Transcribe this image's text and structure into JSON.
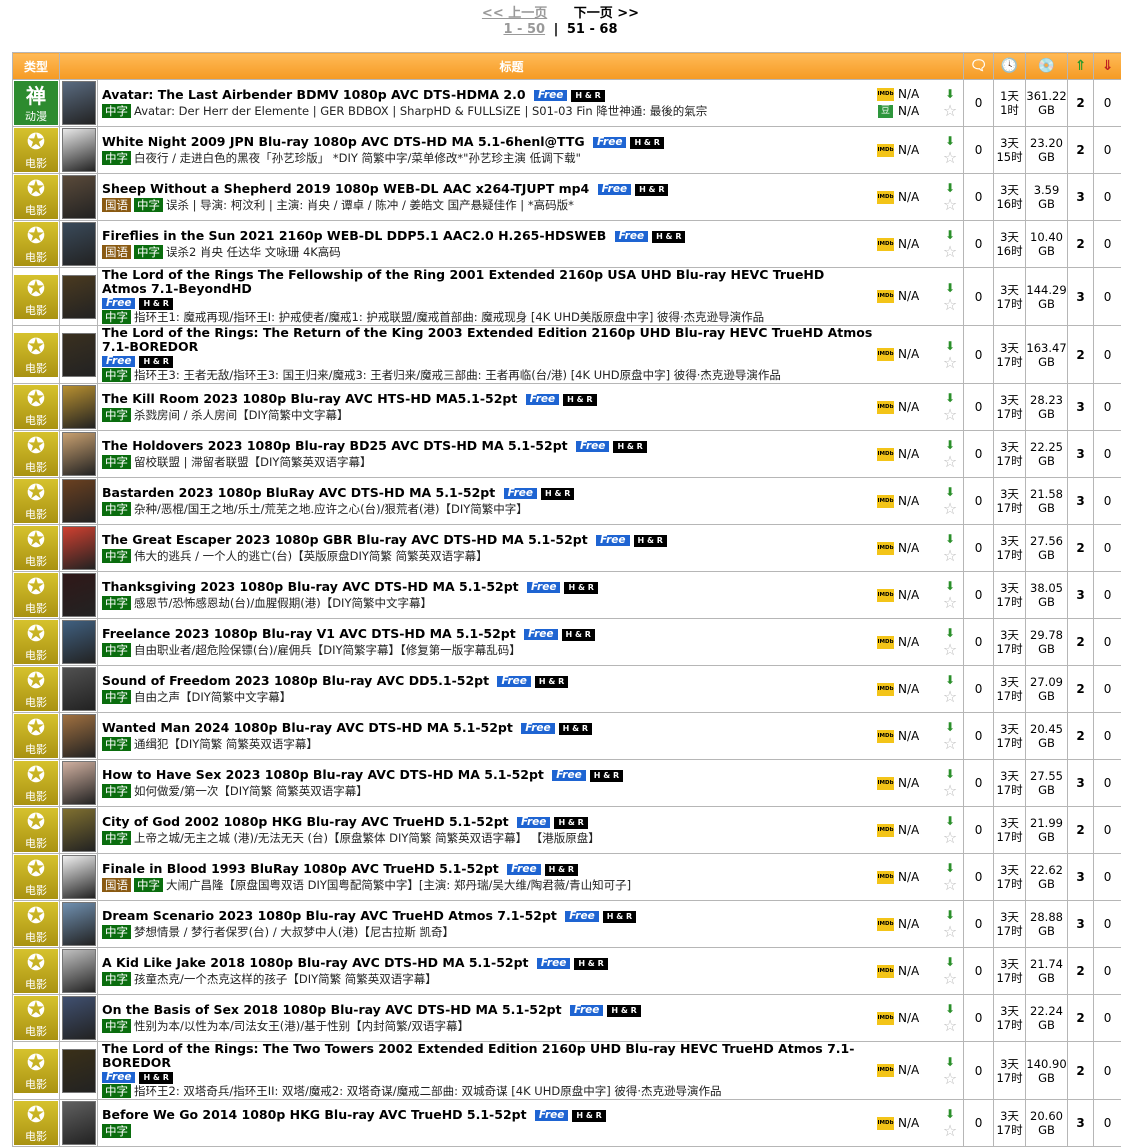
{
  "pager": {
    "prev": "<< 上一页",
    "next": "下一页 >>",
    "range1": "1 - 50",
    "sep": "|",
    "range2": "51 - 68"
  },
  "header": {
    "type": "类型",
    "title": "标题"
  },
  "rows": [
    {
      "cat": "anime",
      "cat_icon": "禅",
      "cat_label": "动漫",
      "color": "#5a6b80",
      "title": "Avatar: The Last Airbender BDMV 1080p AVC DTS-HDMA 2.0",
      "free": "Free",
      "hr": "H & R",
      "wrap": false,
      "tags": [
        "中字"
      ],
      "sub": "Avatar: Der Herr der Elemente | GER BDBOX | SharpHD & FULLSiZE | S01-03 Fin 降世神通: 最後的氣宗",
      "imdb": "N/A",
      "douban": "N/A",
      "comments": "0",
      "t1": "1天",
      "t2": "1时",
      "s1": "361.22",
      "s2": "GB",
      "seed": "2",
      "leech": "0"
    },
    {
      "cat": "movie",
      "cat_icon": "✪",
      "cat_label": "电影",
      "color": "#e8e8e8",
      "title": "White Night 2009 JPN Blu-ray 1080p AVC DTS-HD MA 5.1-6henl@TTG",
      "free": "Free",
      "hr": "H & R",
      "wrap": false,
      "tags": [
        "中字"
      ],
      "sub": "白夜行 / 走进白色的黑夜「孙艺珍版」 *DIY 简繁中字/菜单修改*\"孙艺珍主演 低调下载\"",
      "imdb": "N/A",
      "douban": "",
      "comments": "0",
      "t1": "3天",
      "t2": "15时",
      "s1": "23.20",
      "s2": "GB",
      "seed": "2",
      "leech": "0"
    },
    {
      "cat": "movie",
      "cat_icon": "✪",
      "cat_label": "电影",
      "color": "#5a4a3a",
      "title": "Sheep Without a Shepherd 2019 1080p WEB-DL AAC x264-TJUPT mp4",
      "free": "Free",
      "hr": "H & R",
      "wrap": false,
      "tags": [
        "国语",
        "中字"
      ],
      "sub": "误杀 | 导演: 柯汶利 | 主演: 肖央 / 谭卓 / 陈冲 / 姜皓文 国产悬疑佳作 | *高码版*",
      "imdb": "N/A",
      "douban": "",
      "comments": "0",
      "t1": "3天",
      "t2": "16时",
      "s1": "3.59",
      "s2": "GB",
      "seed": "3",
      "leech": "0"
    },
    {
      "cat": "movie",
      "cat_icon": "✪",
      "cat_label": "电影",
      "color": "#3a4a5a",
      "title": "Fireflies in the Sun 2021 2160p WEB-DL DDP5.1 AAC2.0 H.265-HDSWEB",
      "free": "Free",
      "hr": "H & R",
      "wrap": false,
      "tags": [
        "国语",
        "中字"
      ],
      "sub": "误杀2 肖央 任达华 文咏珊 4K高码",
      "imdb": "N/A",
      "douban": "",
      "comments": "0",
      "t1": "3天",
      "t2": "16时",
      "s1": "10.40",
      "s2": "GB",
      "seed": "2",
      "leech": "0"
    },
    {
      "cat": "movie",
      "cat_icon": "✪",
      "cat_label": "电影",
      "color": "#4a3a20",
      "title": "The Lord of the Rings The Fellowship of the Ring 2001 Extended 2160p USA UHD Blu-ray HEVC TrueHD Atmos 7.1-BeyondHD",
      "free": "Free",
      "hr": "H & R",
      "wrap": true,
      "tags": [
        "中字"
      ],
      "sub": "指环王1: 魔戒再现/指环王I: 护戒使者/魔戒1: 护戒联盟/魔戒首部曲: 魔戒现身 [4K UHD美版原盘中字] 彼得·杰克逊导演作品",
      "imdb": "N/A",
      "douban": "",
      "comments": "0",
      "t1": "3天",
      "t2": "17时",
      "s1": "144.29",
      "s2": "GB",
      "seed": "3",
      "leech": "0"
    },
    {
      "cat": "movie",
      "cat_icon": "✪",
      "cat_label": "电影",
      "color": "#3a3020",
      "title": "The Lord of the Rings: The Return of the King 2003 Extended Edition 2160p UHD Blu-ray HEVC TrueHD Atmos 7.1-BOREDOR",
      "free": "Free",
      "hr": "H & R",
      "wrap": true,
      "tags": [
        "中字"
      ],
      "sub": "指环王3: 王者无敌/指环王3: 国王归来/魔戒3: 王者归来/魔戒三部曲: 王者再临(台/港) [4K UHD原盘中字] 彼得·杰克逊导演作品",
      "imdb": "N/A",
      "douban": "",
      "comments": "0",
      "t1": "3天",
      "t2": "17时",
      "s1": "163.47",
      "s2": "GB",
      "seed": "2",
      "leech": "0"
    },
    {
      "cat": "movie",
      "cat_icon": "✪",
      "cat_label": "电影",
      "color": "#b89030",
      "title": "The Kill Room 2023 1080p Blu-ray AVC HTS-HD MA5.1-52pt",
      "free": "Free",
      "hr": "H & R",
      "wrap": false,
      "tags": [
        "中字"
      ],
      "sub": "杀戮房间 / 杀人房间【DIY简繁中文字幕】",
      "imdb": "N/A",
      "douban": "",
      "comments": "0",
      "t1": "3天",
      "t2": "17时",
      "s1": "28.23",
      "s2": "GB",
      "seed": "3",
      "leech": "0"
    },
    {
      "cat": "movie",
      "cat_icon": "✪",
      "cat_label": "电影",
      "color": "#c8a070",
      "title": "The Holdovers 2023 1080p Blu-ray BD25 AVC DTS-HD MA 5.1-52pt",
      "free": "Free",
      "hr": "H & R",
      "wrap": false,
      "tags": [
        "中字"
      ],
      "sub": "留校联盟 | 滞留者联盟【DIY简繁英双语字幕】",
      "imdb": "N/A",
      "douban": "",
      "comments": "0",
      "t1": "3天",
      "t2": "17时",
      "s1": "22.25",
      "s2": "GB",
      "seed": "3",
      "leech": "0"
    },
    {
      "cat": "movie",
      "cat_icon": "✪",
      "cat_label": "电影",
      "color": "#6a4020",
      "title": "Bastarden 2023 1080p BluRay AVC DTS-HD MA 5.1-52pt",
      "free": "Free",
      "hr": "H & R",
      "wrap": false,
      "tags": [
        "中字"
      ],
      "sub": "杂种/恶棍/国王之地/乐土/荒芜之地.应许之心(台)/狠荒者(港)【DIY简繁中字】",
      "imdb": "N/A",
      "douban": "",
      "comments": "0",
      "t1": "3天",
      "t2": "17时",
      "s1": "21.58",
      "s2": "GB",
      "seed": "3",
      "leech": "0"
    },
    {
      "cat": "movie",
      "cat_icon": "✪",
      "cat_label": "电影",
      "color": "#d04030",
      "title": "The Great Escaper 2023 1080p GBR Blu-ray AVC DTS-HD MA 5.1-52pt",
      "free": "Free",
      "hr": "H & R",
      "wrap": false,
      "tags": [
        "中字"
      ],
      "sub": "伟大的逃兵 / 一个人的逃亡(台)【英版原盘DIY简繁 简繁英双语字幕】",
      "imdb": "N/A",
      "douban": "",
      "comments": "0",
      "t1": "3天",
      "t2": "17时",
      "s1": "27.56",
      "s2": "GB",
      "seed": "2",
      "leech": "0"
    },
    {
      "cat": "movie",
      "cat_icon": "✪",
      "cat_label": "电影",
      "color": "#301818",
      "title": "Thanksgiving 2023 1080p Blu-ray AVC DTS-HD MA 5.1-52pt",
      "free": "Free",
      "hr": "H & R",
      "wrap": false,
      "tags": [
        "中字"
      ],
      "sub": "感恩节/恐怖感恩劫(台)/血腥假期(港)【DIY简繁中文字幕】",
      "imdb": "N/A",
      "douban": "",
      "comments": "0",
      "t1": "3天",
      "t2": "17时",
      "s1": "38.05",
      "s2": "GB",
      "seed": "3",
      "leech": "0"
    },
    {
      "cat": "movie",
      "cat_icon": "✪",
      "cat_label": "电影",
      "color": "#406080",
      "title": "Freelance 2023 1080p Blu-ray V1 AVC DTS-HD MA 5.1-52pt",
      "free": "Free",
      "hr": "H & R",
      "wrap": false,
      "tags": [
        "中字"
      ],
      "sub": "自由职业者/超危险保镖(台)/雇佣兵【DIY简繁字幕】【修复第一版字幕乱码】",
      "imdb": "N/A",
      "douban": "",
      "comments": "0",
      "t1": "3天",
      "t2": "17时",
      "s1": "29.78",
      "s2": "GB",
      "seed": "2",
      "leech": "0"
    },
    {
      "cat": "movie",
      "cat_icon": "✪",
      "cat_label": "电影",
      "color": "#505050",
      "title": "Sound of Freedom 2023 1080p Blu-ray AVC DD5.1-52pt",
      "free": "Free",
      "hr": "H & R",
      "wrap": false,
      "tags": [
        "中字"
      ],
      "sub": "自由之声【DIY简繁中文字幕】",
      "imdb": "N/A",
      "douban": "",
      "comments": "0",
      "t1": "3天",
      "t2": "17时",
      "s1": "27.09",
      "s2": "GB",
      "seed": "2",
      "leech": "0"
    },
    {
      "cat": "movie",
      "cat_icon": "✪",
      "cat_label": "电影",
      "color": "#a07040",
      "title": "Wanted Man 2024 1080p Blu-ray AVC DTS-HD MA 5.1-52pt",
      "free": "Free",
      "hr": "H & R",
      "wrap": false,
      "tags": [
        "中字"
      ],
      "sub": "通缉犯【DIY简繁 简繁英双语字幕】",
      "imdb": "N/A",
      "douban": "",
      "comments": "0",
      "t1": "3天",
      "t2": "17时",
      "s1": "20.45",
      "s2": "GB",
      "seed": "2",
      "leech": "0"
    },
    {
      "cat": "movie",
      "cat_icon": "✪",
      "cat_label": "电影",
      "color": "#d0b0a0",
      "title": "How to Have Sex 2023 1080p Blu-ray AVC DTS-HD MA 5.1-52pt",
      "free": "Free",
      "hr": "H & R",
      "wrap": false,
      "tags": [
        "中字"
      ],
      "sub": "如何做爱/第一次【DIY简繁 简繁英双语字幕】",
      "imdb": "N/A",
      "douban": "",
      "comments": "0",
      "t1": "3天",
      "t2": "17时",
      "s1": "27.55",
      "s2": "GB",
      "seed": "3",
      "leech": "0"
    },
    {
      "cat": "movie",
      "cat_icon": "✪",
      "cat_label": "电影",
      "color": "#807030",
      "title": "City of God 2002 1080p HKG Blu-ray AVC TrueHD 5.1-52pt",
      "free": "Free",
      "hr": "H & R",
      "wrap": false,
      "tags": [
        "中字"
      ],
      "sub": "上帝之城/无主之城 (港)/无法无天 (台)【原盘繁体 DIY简繁 简繁英双语字幕】 【港版原盘】",
      "imdb": "N/A",
      "douban": "",
      "comments": "0",
      "t1": "3天",
      "t2": "17时",
      "s1": "21.99",
      "s2": "GB",
      "seed": "2",
      "leech": "0"
    },
    {
      "cat": "movie",
      "cat_icon": "✪",
      "cat_label": "电影",
      "color": "#f0f0f0",
      "title": "Finale in Blood 1993 BluRay 1080p AVC TrueHD 5.1-52pt",
      "free": "Free",
      "hr": "H & R",
      "wrap": false,
      "tags": [
        "国语",
        "中字"
      ],
      "sub": "大闹广昌隆【原盘国粤双语 DIY国粤配简繁中字】[主演: 郑丹瑞/吴大维/陶君薇/青山知可子]",
      "imdb": "N/A",
      "douban": "",
      "comments": "0",
      "t1": "3天",
      "t2": "17时",
      "s1": "22.62",
      "s2": "GB",
      "seed": "3",
      "leech": "0"
    },
    {
      "cat": "movie",
      "cat_icon": "✪",
      "cat_label": "电影",
      "color": "#7090b0",
      "title": "Dream Scenario 2023 1080p Blu-ray AVC TrueHD Atmos 7.1-52pt",
      "free": "Free",
      "hr": "H & R",
      "wrap": false,
      "tags": [
        "中字"
      ],
      "sub": "梦想情景 / 梦行者保罗(台) / 大叔梦中人(港)【尼古拉斯 凯奇】",
      "imdb": "N/A",
      "douban": "",
      "comments": "0",
      "t1": "3天",
      "t2": "17时",
      "s1": "28.88",
      "s2": "GB",
      "seed": "3",
      "leech": "0"
    },
    {
      "cat": "movie",
      "cat_icon": "✪",
      "cat_label": "电影",
      "color": "#c0c0c0",
      "title": "A Kid Like Jake 2018 1080p Blu-ray AVC DTS-HD MA 5.1-52pt",
      "free": "Free",
      "hr": "H & R",
      "wrap": false,
      "tags": [
        "中字"
      ],
      "sub": "孩童杰克/一个杰克这样的孩子【DIY简繁 简繁英双语字幕】",
      "imdb": "N/A",
      "douban": "",
      "comments": "0",
      "t1": "3天",
      "t2": "17时",
      "s1": "21.74",
      "s2": "GB",
      "seed": "2",
      "leech": "0"
    },
    {
      "cat": "movie",
      "cat_icon": "✪",
      "cat_label": "电影",
      "color": "#405070",
      "title": "On the Basis of Sex 2018 1080p Blu-ray AVC DTS-HD MA 5.1-52pt",
      "free": "Free",
      "hr": "H & R",
      "wrap": false,
      "tags": [
        "中字"
      ],
      "sub": "性别为本/以性为本/司法女王(港)/基于性别【内封简繁/双语字幕】",
      "imdb": "N/A",
      "douban": "",
      "comments": "0",
      "t1": "3天",
      "t2": "17时",
      "s1": "22.24",
      "s2": "GB",
      "seed": "2",
      "leech": "0"
    },
    {
      "cat": "movie",
      "cat_icon": "✪",
      "cat_label": "电影",
      "color": "#3a3018",
      "title": "The Lord of the Rings: The Two Towers 2002 Extended Edition 2160p UHD Blu-ray HEVC TrueHD Atmos 7.1-BOREDOR",
      "free": "Free",
      "hr": "H & R",
      "wrap": true,
      "tags": [
        "中字"
      ],
      "sub": "指环王2: 双塔奇兵/指环王II: 双塔/魔戒2: 双塔奇谋/魔戒二部曲: 双城奇谋 [4K UHD原盘中字] 彼得·杰克逊导演作品",
      "imdb": "N/A",
      "douban": "",
      "comments": "0",
      "t1": "3天",
      "t2": "17时",
      "s1": "140.90",
      "s2": "GB",
      "seed": "2",
      "leech": "0"
    },
    {
      "cat": "movie",
      "cat_icon": "✪",
      "cat_label": "电影",
      "color": "#606060",
      "title": "Before We Go 2014 1080p HKG Blu-ray AVC TrueHD 5.1-52pt",
      "free": "Free",
      "hr": "H & R",
      "wrap": false,
      "tags": [
        "中字"
      ],
      "sub": "",
      "imdb": "N/A",
      "douban": "",
      "comments": "0",
      "t1": "3天",
      "t2": "17时",
      "s1": "20.60",
      "s2": "GB",
      "seed": "3",
      "leech": "0"
    }
  ]
}
